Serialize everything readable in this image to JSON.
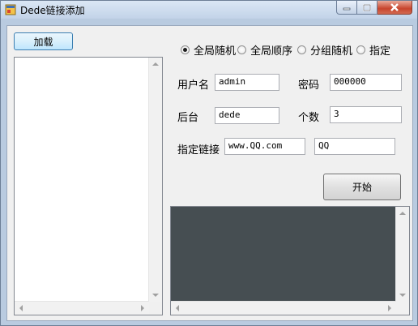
{
  "window": {
    "title": "Dede链接添加",
    "icon": "app-window-icon",
    "controls": [
      "minimize-icon",
      "maximize-icon",
      "close-icon"
    ]
  },
  "load_button": "加载",
  "modes": {
    "options": [
      "全局随机",
      "全局顺序",
      "分组随机",
      "指定"
    ],
    "selected": "全局随机"
  },
  "fields": {
    "username_label": "用户名",
    "username_value": "admin",
    "password_label": "密码",
    "password_value": "000000",
    "admin_label": "后台",
    "admin_value": "dede",
    "count_label": "个数",
    "count_value": "3",
    "link_label": "指定链接",
    "link_url": "www.QQ.com",
    "link_text": "QQ"
  },
  "start_button": "开始",
  "colors": {
    "log_background": "#464e52",
    "title_gradient_top": "#dbe7f5",
    "close_button": "#c7452d"
  }
}
